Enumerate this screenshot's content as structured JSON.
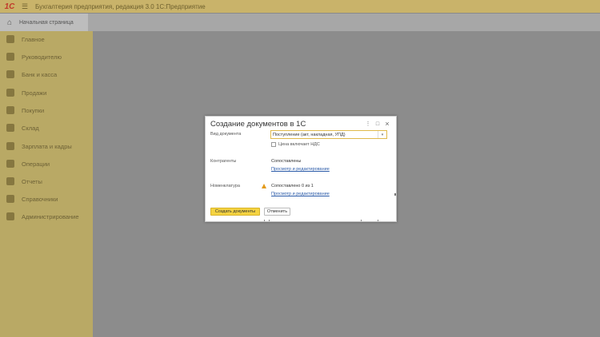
{
  "app": {
    "logo_text": "1С",
    "title": "Бухгалтерия предприятия, редакция 3.0 1С:Предприятие"
  },
  "tabs": {
    "home_label": "Начальная страница"
  },
  "sidebar": {
    "items": [
      {
        "label": "Главное",
        "icon": "home-icon"
      },
      {
        "label": "Руководителю",
        "icon": "chart-icon"
      },
      {
        "label": "Банк и касса",
        "icon": "bank-icon"
      },
      {
        "label": "Продажи",
        "icon": "cart-icon"
      },
      {
        "label": "Покупки",
        "icon": "basket-icon"
      },
      {
        "label": "Склад",
        "icon": "warehouse-icon"
      },
      {
        "label": "Зарплата и кадры",
        "icon": "person-icon"
      },
      {
        "label": "Операции",
        "icon": "operations-icon"
      },
      {
        "label": "Отчеты",
        "icon": "report-icon"
      },
      {
        "label": "Справочники",
        "icon": "book-icon"
      },
      {
        "label": "Администрирование",
        "icon": "gear-icon"
      }
    ]
  },
  "dialog": {
    "title": "Создание документов в 1С",
    "doc_type_label": "Вид документа",
    "doc_type_value": "Поступление (акт, накладная, УПД)",
    "vat_checkbox_label": "Цена включает НДС",
    "vat_checked": false,
    "counterparties_label": "Контрагенты",
    "counterparties_status": "Сопоставлены",
    "counterparties_link": "Просмотр и редактирование",
    "nomenclature_label": "Номенклатура",
    "nomenclature_status": "Сопоставлено 0 из 1",
    "nomenclature_link": "Просмотр и редактирование",
    "create_button": "Создать документы",
    "cancel_button": "Отменить",
    "menu_icon": "⋮",
    "maximize_icon": "□",
    "close_icon": "×"
  },
  "colors": {
    "sidebar": "#b9a965",
    "titlebar": "#c9b36a",
    "primary_button": "#f5d341",
    "link": "#2a5aa8",
    "warning": "#e39a1b"
  }
}
